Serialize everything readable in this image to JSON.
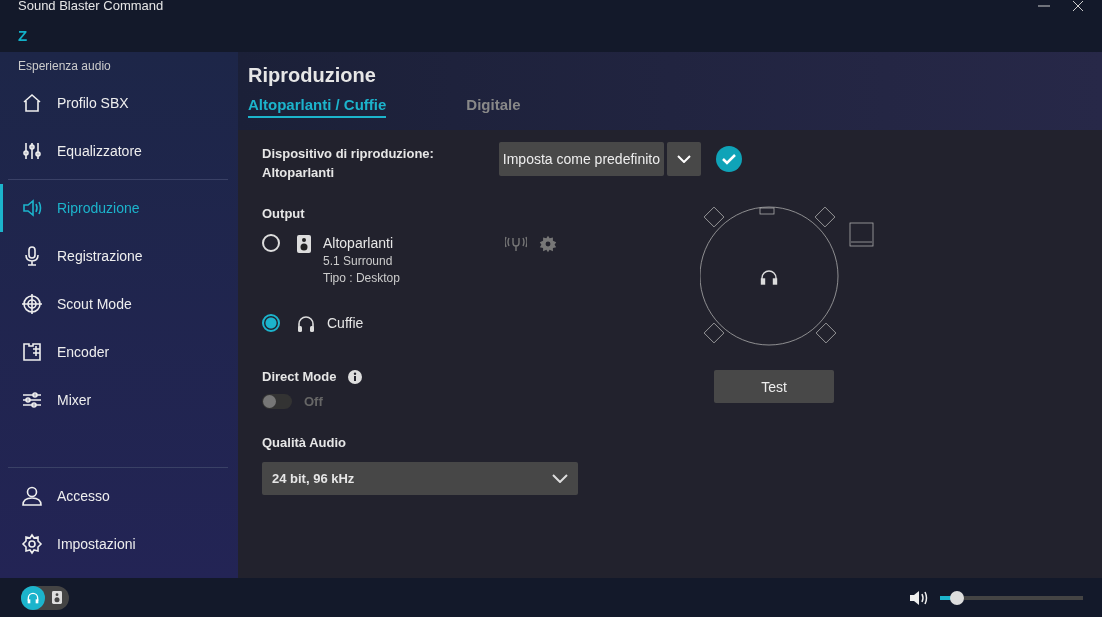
{
  "window": {
    "title": "Sound Blaster Command",
    "logo": "Z"
  },
  "sidebar": {
    "section_label": "Esperienza audio",
    "items": [
      {
        "label": "Profilo SBX",
        "selected": false
      },
      {
        "label": "Equalizzatore",
        "selected": false
      },
      {
        "label": "Riproduzione",
        "selected": true
      },
      {
        "label": "Registrazione",
        "selected": false
      },
      {
        "label": "Scout Mode",
        "selected": false
      },
      {
        "label": "Encoder",
        "selected": false
      },
      {
        "label": "Mixer",
        "selected": false
      }
    ],
    "bottom_items": [
      {
        "label": "Accesso",
        "selected": false
      },
      {
        "label": "Impostazioni",
        "selected": false
      }
    ]
  },
  "page": {
    "title": "Riproduzione",
    "tabs": [
      {
        "label": "Altoparlanti / Cuffie",
        "selected": true
      },
      {
        "label": "Digitale",
        "selected": false
      }
    ],
    "device_label": "Dispositivo di riproduzione:",
    "device_name": "Altoparlanti",
    "default_button": "Imposta come predefinito",
    "output_label": "Output",
    "outputs": [
      {
        "name": "Altoparlanti",
        "details": [
          "5.1 Surround",
          "Tipo :  Desktop"
        ],
        "selected": false
      },
      {
        "name": "Cuffie",
        "selected": true
      }
    ],
    "direct_mode": {
      "label": "Direct Mode",
      "on": false,
      "state_text": "Off"
    },
    "quality": {
      "label": "Qualità Audio",
      "value": "24 bit, 96 kHz"
    },
    "test_button": "Test"
  },
  "footer": {
    "output_switch": {
      "headphones_selected": true
    },
    "volume": {
      "level": 0.12
    }
  }
}
